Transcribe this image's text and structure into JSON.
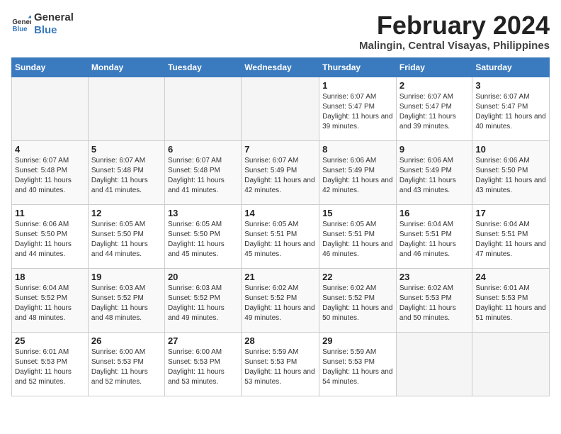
{
  "logo": {
    "text_general": "General",
    "text_blue": "Blue"
  },
  "title": "February 2024",
  "subtitle": "Malingin, Central Visayas, Philippines",
  "days_of_week": [
    "Sunday",
    "Monday",
    "Tuesday",
    "Wednesday",
    "Thursday",
    "Friday",
    "Saturday"
  ],
  "weeks": [
    [
      {
        "day": "",
        "sunrise": "",
        "sunset": "",
        "daylight": "",
        "empty": true
      },
      {
        "day": "",
        "sunrise": "",
        "sunset": "",
        "daylight": "",
        "empty": true
      },
      {
        "day": "",
        "sunrise": "",
        "sunset": "",
        "daylight": "",
        "empty": true
      },
      {
        "day": "",
        "sunrise": "",
        "sunset": "",
        "daylight": "",
        "empty": true
      },
      {
        "day": "1",
        "sunrise": "6:07 AM",
        "sunset": "5:47 PM",
        "daylight": "11 hours and 39 minutes.",
        "empty": false
      },
      {
        "day": "2",
        "sunrise": "6:07 AM",
        "sunset": "5:47 PM",
        "daylight": "11 hours and 39 minutes.",
        "empty": false
      },
      {
        "day": "3",
        "sunrise": "6:07 AM",
        "sunset": "5:47 PM",
        "daylight": "11 hours and 40 minutes.",
        "empty": false
      }
    ],
    [
      {
        "day": "4",
        "sunrise": "6:07 AM",
        "sunset": "5:48 PM",
        "daylight": "11 hours and 40 minutes.",
        "empty": false
      },
      {
        "day": "5",
        "sunrise": "6:07 AM",
        "sunset": "5:48 PM",
        "daylight": "11 hours and 41 minutes.",
        "empty": false
      },
      {
        "day": "6",
        "sunrise": "6:07 AM",
        "sunset": "5:48 PM",
        "daylight": "11 hours and 41 minutes.",
        "empty": false
      },
      {
        "day": "7",
        "sunrise": "6:07 AM",
        "sunset": "5:49 PM",
        "daylight": "11 hours and 42 minutes.",
        "empty": false
      },
      {
        "day": "8",
        "sunrise": "6:06 AM",
        "sunset": "5:49 PM",
        "daylight": "11 hours and 42 minutes.",
        "empty": false
      },
      {
        "day": "9",
        "sunrise": "6:06 AM",
        "sunset": "5:49 PM",
        "daylight": "11 hours and 43 minutes.",
        "empty": false
      },
      {
        "day": "10",
        "sunrise": "6:06 AM",
        "sunset": "5:50 PM",
        "daylight": "11 hours and 43 minutes.",
        "empty": false
      }
    ],
    [
      {
        "day": "11",
        "sunrise": "6:06 AM",
        "sunset": "5:50 PM",
        "daylight": "11 hours and 44 minutes.",
        "empty": false
      },
      {
        "day": "12",
        "sunrise": "6:05 AM",
        "sunset": "5:50 PM",
        "daylight": "11 hours and 44 minutes.",
        "empty": false
      },
      {
        "day": "13",
        "sunrise": "6:05 AM",
        "sunset": "5:50 PM",
        "daylight": "11 hours and 45 minutes.",
        "empty": false
      },
      {
        "day": "14",
        "sunrise": "6:05 AM",
        "sunset": "5:51 PM",
        "daylight": "11 hours and 45 minutes.",
        "empty": false
      },
      {
        "day": "15",
        "sunrise": "6:05 AM",
        "sunset": "5:51 PM",
        "daylight": "11 hours and 46 minutes.",
        "empty": false
      },
      {
        "day": "16",
        "sunrise": "6:04 AM",
        "sunset": "5:51 PM",
        "daylight": "11 hours and 46 minutes.",
        "empty": false
      },
      {
        "day": "17",
        "sunrise": "6:04 AM",
        "sunset": "5:51 PM",
        "daylight": "11 hours and 47 minutes.",
        "empty": false
      }
    ],
    [
      {
        "day": "18",
        "sunrise": "6:04 AM",
        "sunset": "5:52 PM",
        "daylight": "11 hours and 48 minutes.",
        "empty": false
      },
      {
        "day": "19",
        "sunrise": "6:03 AM",
        "sunset": "5:52 PM",
        "daylight": "11 hours and 48 minutes.",
        "empty": false
      },
      {
        "day": "20",
        "sunrise": "6:03 AM",
        "sunset": "5:52 PM",
        "daylight": "11 hours and 49 minutes.",
        "empty": false
      },
      {
        "day": "21",
        "sunrise": "6:02 AM",
        "sunset": "5:52 PM",
        "daylight": "11 hours and 49 minutes.",
        "empty": false
      },
      {
        "day": "22",
        "sunrise": "6:02 AM",
        "sunset": "5:52 PM",
        "daylight": "11 hours and 50 minutes.",
        "empty": false
      },
      {
        "day": "23",
        "sunrise": "6:02 AM",
        "sunset": "5:53 PM",
        "daylight": "11 hours and 50 minutes.",
        "empty": false
      },
      {
        "day": "24",
        "sunrise": "6:01 AM",
        "sunset": "5:53 PM",
        "daylight": "11 hours and 51 minutes.",
        "empty": false
      }
    ],
    [
      {
        "day": "25",
        "sunrise": "6:01 AM",
        "sunset": "5:53 PM",
        "daylight": "11 hours and 52 minutes.",
        "empty": false
      },
      {
        "day": "26",
        "sunrise": "6:00 AM",
        "sunset": "5:53 PM",
        "daylight": "11 hours and 52 minutes.",
        "empty": false
      },
      {
        "day": "27",
        "sunrise": "6:00 AM",
        "sunset": "5:53 PM",
        "daylight": "11 hours and 53 minutes.",
        "empty": false
      },
      {
        "day": "28",
        "sunrise": "5:59 AM",
        "sunset": "5:53 PM",
        "daylight": "11 hours and 53 minutes.",
        "empty": false
      },
      {
        "day": "29",
        "sunrise": "5:59 AM",
        "sunset": "5:53 PM",
        "daylight": "11 hours and 54 minutes.",
        "empty": false
      },
      {
        "day": "",
        "sunrise": "",
        "sunset": "",
        "daylight": "",
        "empty": true
      },
      {
        "day": "",
        "sunrise": "",
        "sunset": "",
        "daylight": "",
        "empty": true
      }
    ]
  ],
  "labels": {
    "sunrise": "Sunrise:",
    "sunset": "Sunset:",
    "daylight": "Daylight:"
  }
}
